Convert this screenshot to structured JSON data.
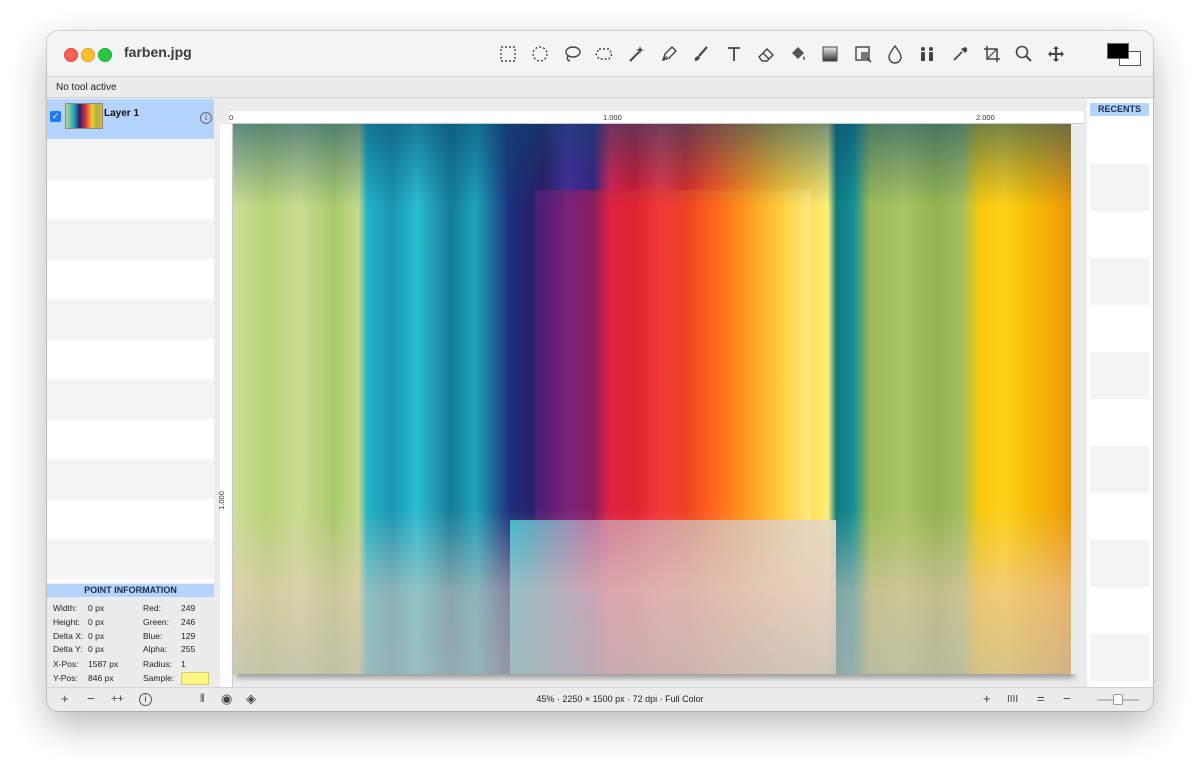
{
  "window": {
    "title": "farben.jpg"
  },
  "toolbar": {
    "tools": [
      "rect-select",
      "ellipse-select",
      "lasso",
      "polygon-select",
      "magic-wand",
      "pen",
      "brush",
      "text",
      "eraser",
      "fill-bucket",
      "gradient",
      "clone-stamp",
      "blur-drop",
      "people",
      "eyedropper",
      "crop",
      "zoom",
      "move"
    ]
  },
  "status": {
    "text": "No tool active"
  },
  "layers": {
    "items": [
      {
        "name": "Layer 1",
        "visible": true
      }
    ]
  },
  "point_info": {
    "header": "POINT INFORMATION",
    "width": {
      "label": "Width:",
      "value": "0 px"
    },
    "height": {
      "label": "Height:",
      "value": "0 px"
    },
    "delta_x": {
      "label": "Delta X:",
      "value": "0 px"
    },
    "delta_y": {
      "label": "Delta Y:",
      "value": "0 px"
    },
    "x_pos": {
      "label": "X-Pos:",
      "value": "1587 px"
    },
    "y_pos": {
      "label": "Y-Pos:",
      "value": "846 px"
    },
    "red": {
      "label": "Red:",
      "value": "249"
    },
    "green": {
      "label": "Green:",
      "value": "246"
    },
    "blue": {
      "label": "Blue:",
      "value": "129"
    },
    "alpha": {
      "label": "Alpha:",
      "value": "255"
    },
    "radius": {
      "label": "Radius:",
      "value": "1"
    },
    "sample": {
      "label": "Sample:",
      "color": "#f9f681"
    }
  },
  "ruler": {
    "top": [
      "0",
      "1.000",
      "2.000"
    ],
    "left": [
      "1.000"
    ]
  },
  "recents": {
    "header": "RECENTS"
  },
  "bottom": {
    "status": "45% · 2250 × 1500 px · 72 dpi · Full Color"
  },
  "colors": {
    "accent": "#b4d4fd",
    "front": "#000000",
    "back": "#ffffff"
  }
}
